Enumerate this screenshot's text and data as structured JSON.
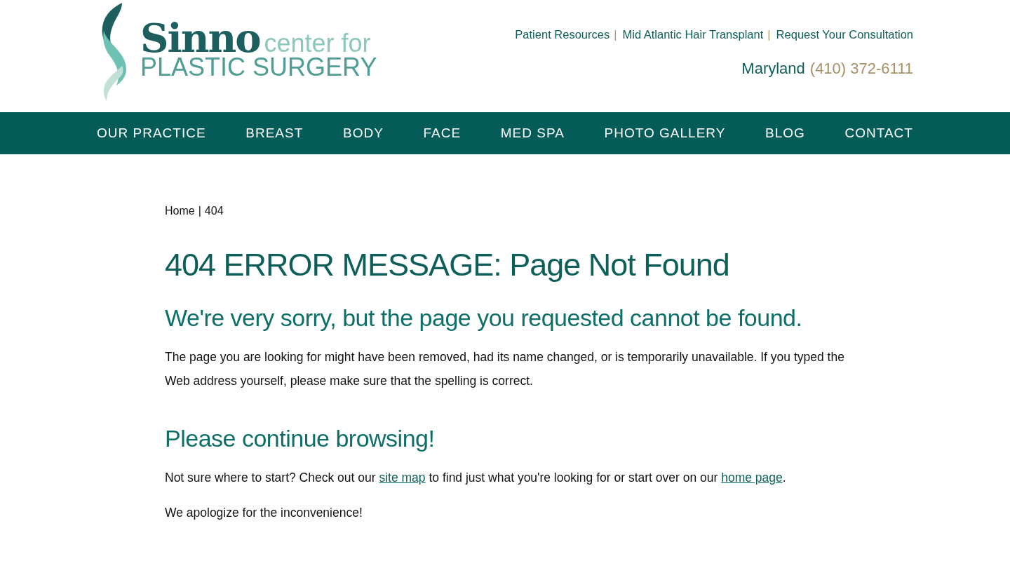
{
  "logo": {
    "name": "Sinno",
    "tagline_1": "center for",
    "tagline_2": "PLASTIC SURGERY"
  },
  "top_links": [
    {
      "kind": "link",
      "text": "Patient Resources"
    },
    {
      "kind": "separator",
      "text": "|"
    },
    {
      "kind": "link",
      "text": "Mid Atlantic Hair Transplant"
    },
    {
      "kind": "separator",
      "text": "|"
    },
    {
      "kind": "link",
      "text": "Request Your Consultation"
    }
  ],
  "phone": {
    "region": "Maryland",
    "number": "(410) 372-6111"
  },
  "nav": [
    "OUR PRACTICE",
    "BREAST",
    "BODY",
    "FACE",
    "MED SPA",
    "PHOTO GALLERY",
    "BLOG",
    "CONTACT"
  ],
  "breadcrumb": {
    "items": [
      "Home",
      "404"
    ],
    "separator": "|"
  },
  "title": "404 ERROR MESSAGE: Page Not Found",
  "subtitle": "We're very sorry, but the page you requested cannot be found.",
  "intro": "The page you are looking for might have been removed, had its name changed, or is temporarily unavailable. If you typed the Web address yourself, please make sure that the spelling is correct.",
  "continue_heading": "Please continue browsing!",
  "continue_text": [
    {
      "kind": "text",
      "text": "Not sure where to start? Check out our "
    },
    {
      "kind": "link",
      "text": "site map"
    },
    {
      "kind": "text",
      "text": " to find just what you're looking for or start over on our "
    },
    {
      "kind": "link",
      "text": "home page"
    },
    {
      "kind": "text",
      "text": "."
    }
  ],
  "closing": "We apologize for the inconvenience!"
}
